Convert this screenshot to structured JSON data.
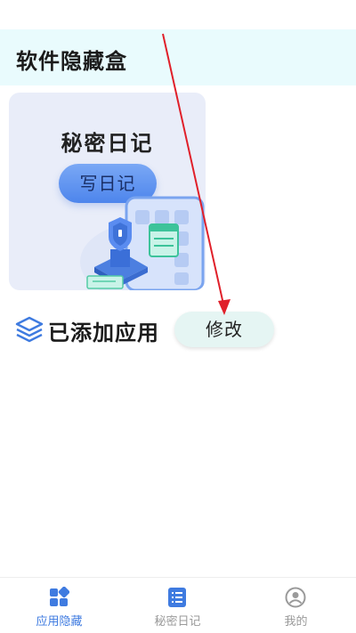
{
  "header": {
    "title": "软件隐藏盒"
  },
  "diary_card": {
    "title": "秘密日记",
    "button_label": "写日记"
  },
  "apps_section": {
    "title": "已添加应用",
    "edit_label": "修改"
  },
  "bottom_nav": {
    "items": [
      {
        "label": "应用隐藏",
        "icon": "grid-icon",
        "active": true
      },
      {
        "label": "秘密日记",
        "icon": "list-icon",
        "active": false
      },
      {
        "label": "我的",
        "icon": "person-icon",
        "active": false
      }
    ]
  },
  "colors": {
    "header_bg": "#e9fbfd",
    "card_bg": "#e9edf9",
    "accent_blue": "#3f7be0",
    "nav_inactive": "#9a9a9a",
    "arrow": "#e0202a"
  }
}
